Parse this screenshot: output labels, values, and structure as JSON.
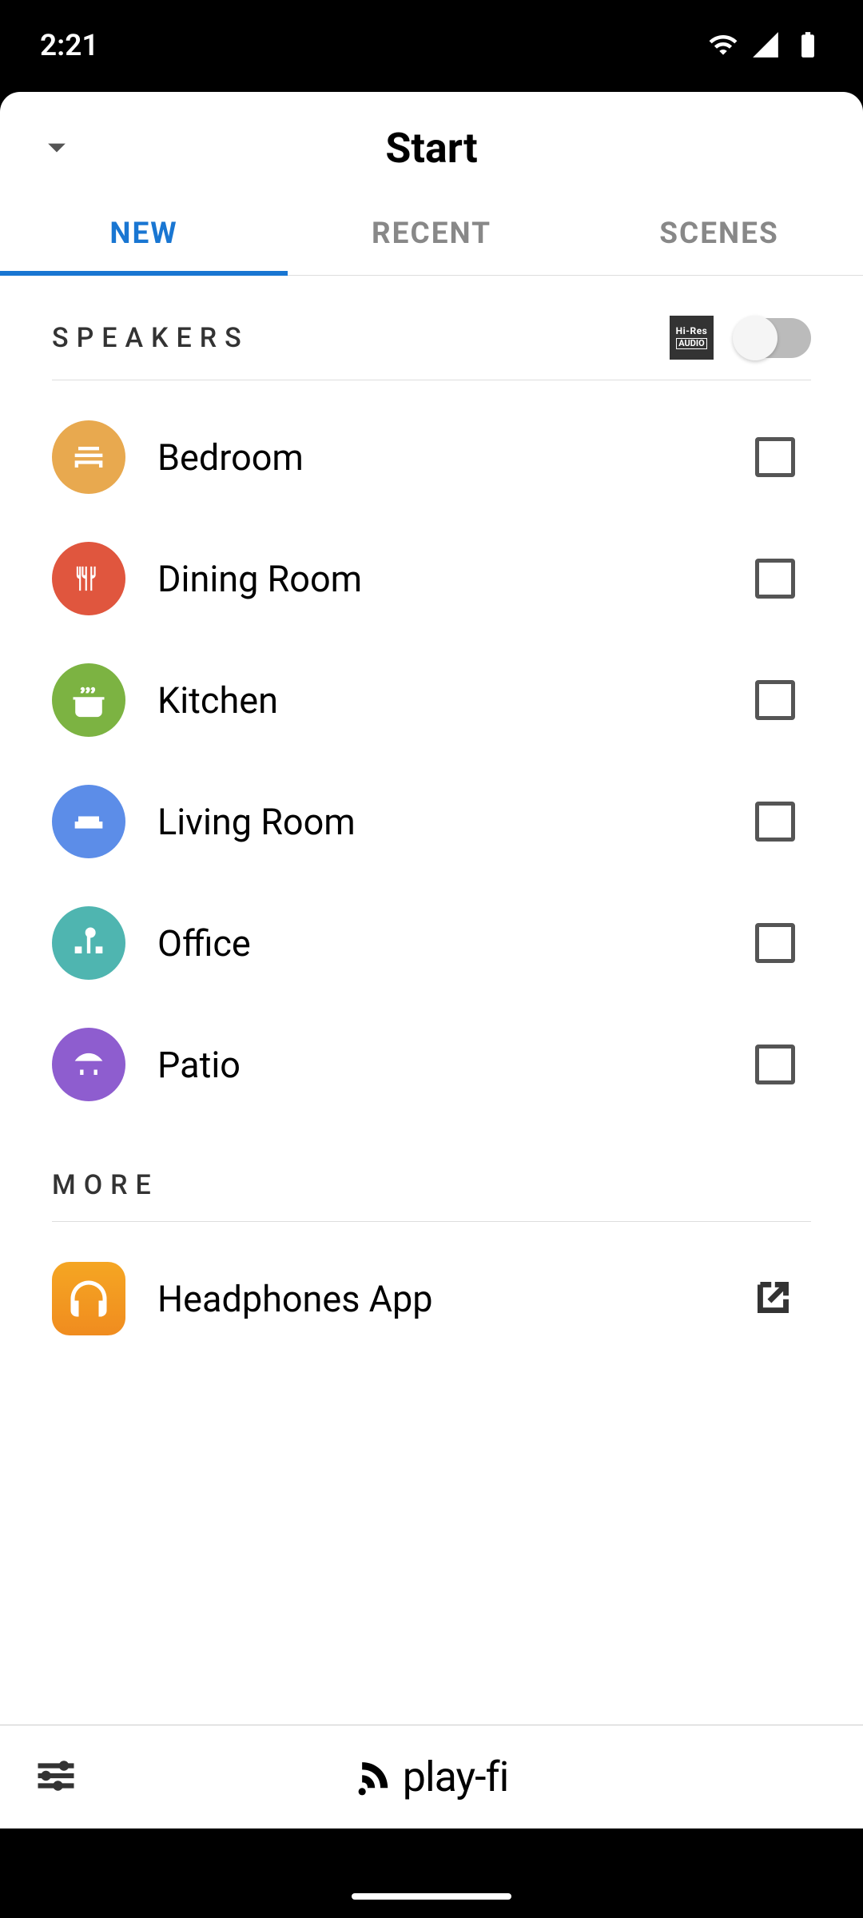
{
  "status": {
    "time": "2:21"
  },
  "header": {
    "title": "Start"
  },
  "tabs": {
    "new": "NEW",
    "recent": "RECENT",
    "scenes": "SCENES"
  },
  "sections": {
    "speakers_title": "SPEAKERS",
    "more_title": "MORE",
    "hires_label": "Hi-Res AUDIO"
  },
  "speakers": [
    {
      "label": "Bedroom",
      "color": "bg-bedroom",
      "icon": "bed-icon"
    },
    {
      "label": "Dining Room",
      "color": "bg-dining",
      "icon": "cutlery-icon"
    },
    {
      "label": "Kitchen",
      "color": "bg-kitchen",
      "icon": "pot-icon"
    },
    {
      "label": "Living Room",
      "color": "bg-living",
      "icon": "sofa-icon"
    },
    {
      "label": "Office",
      "color": "bg-office",
      "icon": "desk-icon"
    },
    {
      "label": "Patio",
      "color": "bg-patio",
      "icon": "patio-icon"
    }
  ],
  "more": [
    {
      "label": "Headphones App",
      "color": "bg-headphones",
      "icon": "headphones-icon"
    }
  ],
  "footer": {
    "brand": "play-fi"
  }
}
